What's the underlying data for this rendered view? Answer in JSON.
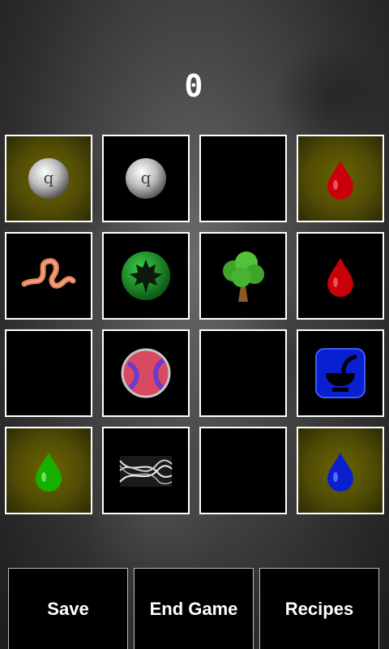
{
  "score": "0",
  "board": {
    "cells": [
      {
        "row": 0,
        "col": 0,
        "item": "pearl-icon",
        "highlighted": true
      },
      {
        "row": 0,
        "col": 1,
        "item": "pearl-icon",
        "highlighted": false
      },
      {
        "row": 0,
        "col": 2,
        "item": "empty",
        "highlighted": false
      },
      {
        "row": 0,
        "col": 3,
        "item": "red-drop-icon",
        "highlighted": true
      },
      {
        "row": 1,
        "col": 0,
        "item": "worm-icon",
        "highlighted": false
      },
      {
        "row": 1,
        "col": 1,
        "item": "leaf-orb-icon",
        "highlighted": false
      },
      {
        "row": 1,
        "col": 2,
        "item": "tree-icon",
        "highlighted": false
      },
      {
        "row": 1,
        "col": 3,
        "item": "red-drop-icon",
        "highlighted": false
      },
      {
        "row": 2,
        "col": 0,
        "item": "empty",
        "highlighted": false
      },
      {
        "row": 2,
        "col": 1,
        "item": "ball-icon",
        "highlighted": false
      },
      {
        "row": 2,
        "col": 2,
        "item": "empty",
        "highlighted": false
      },
      {
        "row": 2,
        "col": 3,
        "item": "mortar-pestle-icon",
        "highlighted": false
      },
      {
        "row": 3,
        "col": 0,
        "item": "green-drop-icon",
        "highlighted": true
      },
      {
        "row": 3,
        "col": 1,
        "item": "fiber-icon",
        "highlighted": false
      },
      {
        "row": 3,
        "col": 2,
        "item": "empty",
        "highlighted": false
      },
      {
        "row": 3,
        "col": 3,
        "item": "blue-drop-icon",
        "highlighted": true
      }
    ]
  },
  "buttons": {
    "save": "Save",
    "end_game": "End Game",
    "recipes": "Recipes"
  },
  "colors": {
    "highlight": "#5b5604",
    "cell_border": "#ffffff",
    "red_drop": "#c8000a",
    "green_drop": "#16b000",
    "blue_drop": "#0a1fd0"
  }
}
